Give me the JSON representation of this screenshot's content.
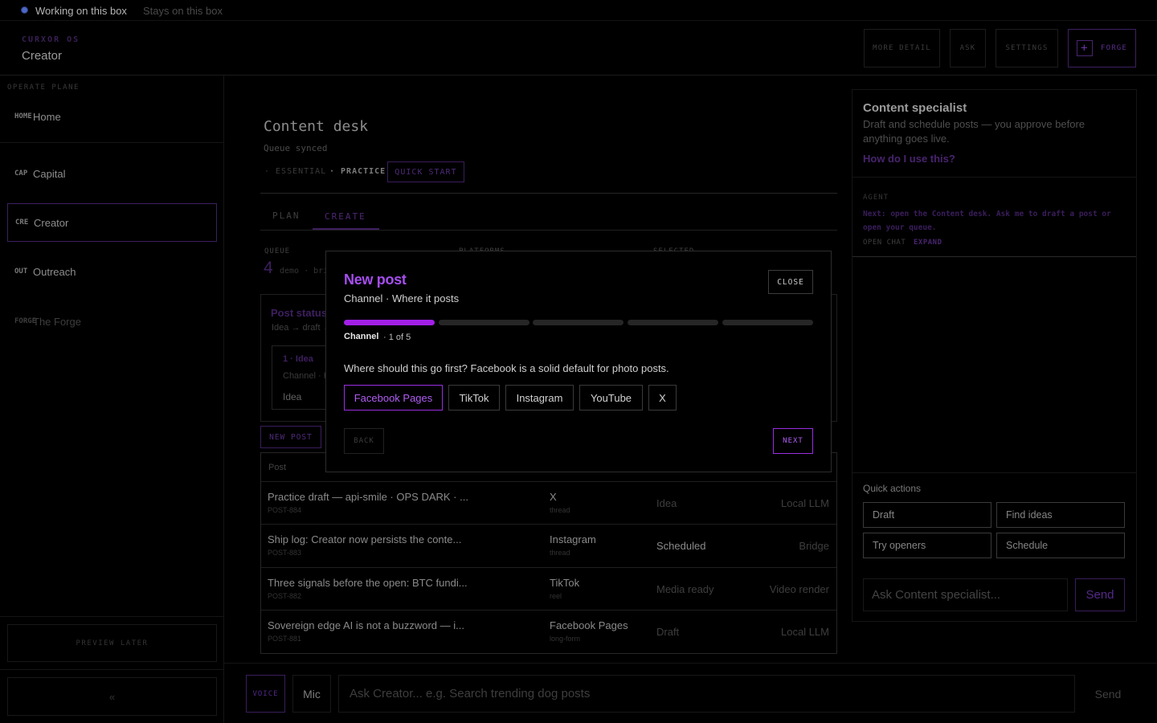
{
  "topbar": {
    "working": "Working on this box",
    "stays": "Stays on this box"
  },
  "header": {
    "kicker": "CURXOR OS",
    "title": "Creator",
    "buttons": {
      "more_detail": "MORE DETAIL",
      "ask": "ASK",
      "settings": "SETTINGS",
      "forge": "FORGE",
      "forge_icon": "+"
    }
  },
  "sidebar": {
    "plane_label": "OPERATE PLANE",
    "items": [
      {
        "code": "HOME",
        "label": "Home"
      },
      {
        "code": "CAP",
        "label": "Capital"
      },
      {
        "code": "CRE",
        "label": "Creator"
      },
      {
        "code": "OUT",
        "label": "Outreach"
      },
      {
        "code": "FORGE",
        "label": "The Forge"
      }
    ],
    "preview_later": "PREVIEW LATER",
    "collapse": "«"
  },
  "main": {
    "title": "Content desk",
    "subtitle": "Queue synced",
    "modes": {
      "essential": "· ESSENTIAL",
      "practice": "· PRACTICE",
      "quick_start": "QUICK START"
    },
    "tabs": {
      "plan": "PLAN",
      "create": "CREATE"
    },
    "kickers": {
      "queue": "QUEUE",
      "platforms": "PLATFORMS",
      "selected": "SELECTED"
    },
    "queue_count": "4",
    "queue_note": "demo · bri",
    "status_card": {
      "title": "Post status",
      "subtitle": "Idea → draft →",
      "idea_title": "1 · Idea",
      "idea_sub": "Channel · H",
      "idea_value": "Idea"
    },
    "new_post_button": "NEW POST",
    "table": {
      "header_post": "Post",
      "rows": [
        {
          "title": "Practice draft — api-smile · OPS DARK · ...",
          "id": "POST-884",
          "platform": "X",
          "format": "thread",
          "status": "Idea",
          "engine": "Local LLM"
        },
        {
          "title": "Ship log: Creator now persists the conte...",
          "id": "POST-883",
          "platform": "Instagram",
          "format": "thread",
          "status": "Scheduled",
          "engine": "Bridge"
        },
        {
          "title": "Three signals before the open: BTC fundi...",
          "id": "POST-882",
          "platform": "TikTok",
          "format": "reel",
          "status": "Media ready",
          "engine": "Video render"
        },
        {
          "title": "Sovereign edge AI is not a buzzword — i...",
          "id": "POST-881",
          "platform": "Facebook Pages",
          "format": "long-form",
          "status": "Draft",
          "engine": "Local LLM"
        }
      ]
    }
  },
  "right_panel": {
    "title": "Content specialist",
    "description": "Draft and schedule posts — you approve before anything goes live.",
    "help_link": "How do I use this?",
    "agent_kicker": "AGENT",
    "agent_message": "Next: open the Content desk. Ask me to draft a post or open your queue.",
    "open_chat": "OPEN CHAT",
    "expand": "EXPAND",
    "quick_actions_label": "Quick actions",
    "quick_actions": [
      "Draft",
      "Find ideas",
      "Try openers",
      "Schedule"
    ],
    "ask_placeholder": "Ask Content specialist...",
    "send": "Send"
  },
  "bottom_bar": {
    "voice": "VOICE",
    "mic": "Mic",
    "placeholder": "Ask Creator... e.g. Search trending dog posts",
    "send": "Send"
  },
  "modal": {
    "title": "New post",
    "subtitle": "Channel · Where it posts",
    "close": "CLOSE",
    "progress": {
      "current_step": 1,
      "total_steps": 5
    },
    "step_name": "Channel",
    "step_count": "· 1 of 5",
    "question": "Where should this go first? Facebook is a solid default for photo posts.",
    "options": [
      "Facebook Pages",
      "TikTok",
      "Instagram",
      "YouTube",
      "X"
    ],
    "selected_option": "Facebook Pages",
    "back": "BACK",
    "next": "NEXT"
  },
  "colors": {
    "accent": "#a21fe6",
    "accent_text": "#b15df5",
    "background": "#000000"
  }
}
